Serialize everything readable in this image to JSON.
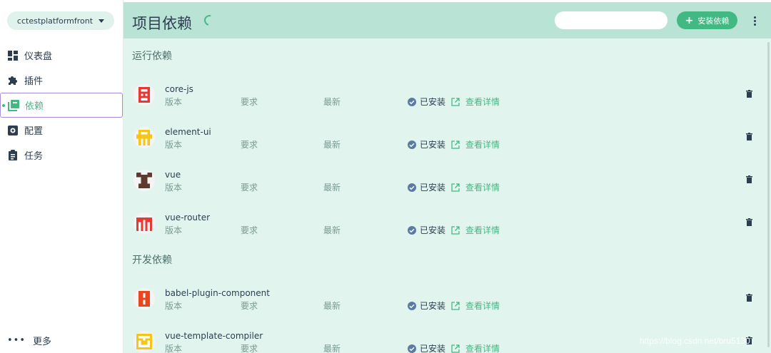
{
  "sidebar": {
    "project": "cctestplatformfront",
    "items": [
      {
        "label": "仪表盘",
        "icon": "dashboard-icon"
      },
      {
        "label": "插件",
        "icon": "puzzle-icon"
      },
      {
        "label": "依赖",
        "icon": "library-icon"
      },
      {
        "label": "配置",
        "icon": "settings-box-icon"
      },
      {
        "label": "任务",
        "icon": "clipboard-icon"
      }
    ],
    "more": "更多"
  },
  "header": {
    "title": "项目依赖",
    "search_placeholder": "",
    "install_label": "安装依赖"
  },
  "sections": [
    {
      "title": "运行依赖",
      "deps": [
        {
          "name": "core-js",
          "icon_color": "#e53935"
        },
        {
          "name": "element-ui",
          "icon_color": "#f5c518"
        },
        {
          "name": "vue",
          "icon_color": "#5d3a2e"
        },
        {
          "name": "vue-router",
          "icon_color": "#e53935"
        }
      ]
    },
    {
      "title": "开发依赖",
      "deps": [
        {
          "name": "babel-plugin-component",
          "icon_color": "#e8461e"
        },
        {
          "name": "vue-template-compiler",
          "icon_color": "#f5c518"
        }
      ]
    }
  ],
  "labels": {
    "version": "版本",
    "required": "要求",
    "latest": "最新",
    "installed": "已安装",
    "details": "查看详情"
  },
  "colors": {
    "accent": "#42b983",
    "header_bg": "#b9e3d4",
    "content_bg": "#e1f4ee"
  },
  "watermark": "https://blog.csdn.net/bru5130"
}
